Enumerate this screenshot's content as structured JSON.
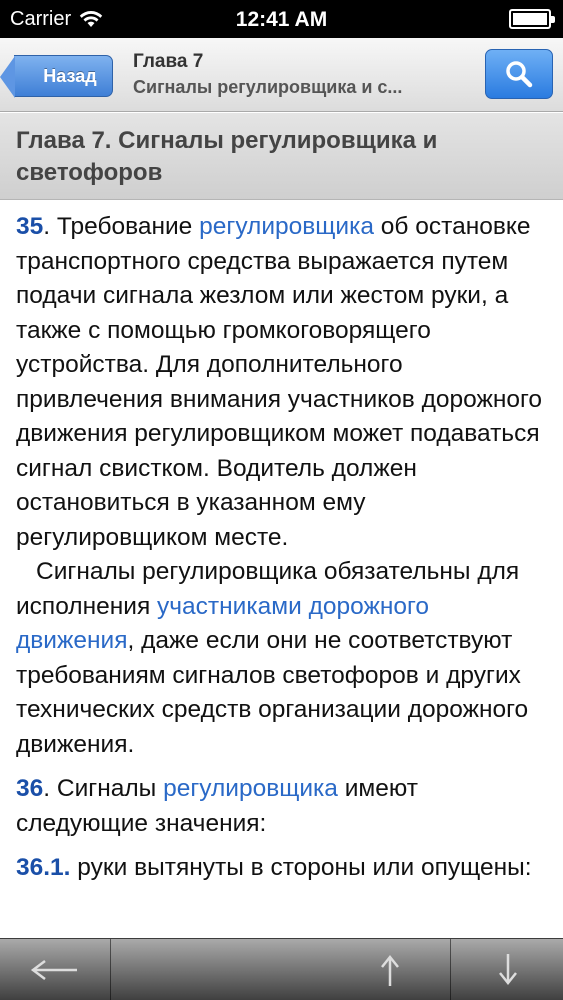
{
  "status_bar": {
    "carrier": "Carrier",
    "time": "12:41 AM"
  },
  "nav": {
    "back_label": "Назад",
    "title": "Глава 7",
    "subtitle": "Сигналы регулировщика и с..."
  },
  "chapter": {
    "title": "Глава 7. Сигналы регулировщика и светофоров"
  },
  "content": {
    "p35": {
      "num": "35",
      "t1": ". Требование ",
      "link1": "регулировщика",
      "t2": " об остановке транспортного средства выражается путем подачи сигнала жезлом или жестом руки, а также с помощью громкоговорящего устройства. Для дополнительного привлечения внимания участников дорожного движения регулировщиком может подаваться сигнал свистком. Водитель должен остановиться в указанном ему регулировщиком месте."
    },
    "p35b": {
      "t1": "Сигналы регулировщика обязательны для исполнения ",
      "link1": "участниками дорожного движения",
      "t2": ", даже если они не соответствуют требованиям сигналов светофоров и других технических средств организации дорожного движения."
    },
    "p36": {
      "num": "36",
      "t1": ". Сигналы ",
      "link1": "регулировщика",
      "t2": " имеют следующие значения:"
    },
    "p361": {
      "num": "36.1.",
      "t1": " руки вытянуты в стороны или опущены:"
    }
  },
  "toolbar": {
    "icons": [
      "back-arrow-icon",
      "up-arrow-icon",
      "down-arrow-icon"
    ]
  },
  "colors": {
    "link": "#2a69c7",
    "number": "#1a4fa8",
    "nav_button": "#3f7fd6"
  }
}
